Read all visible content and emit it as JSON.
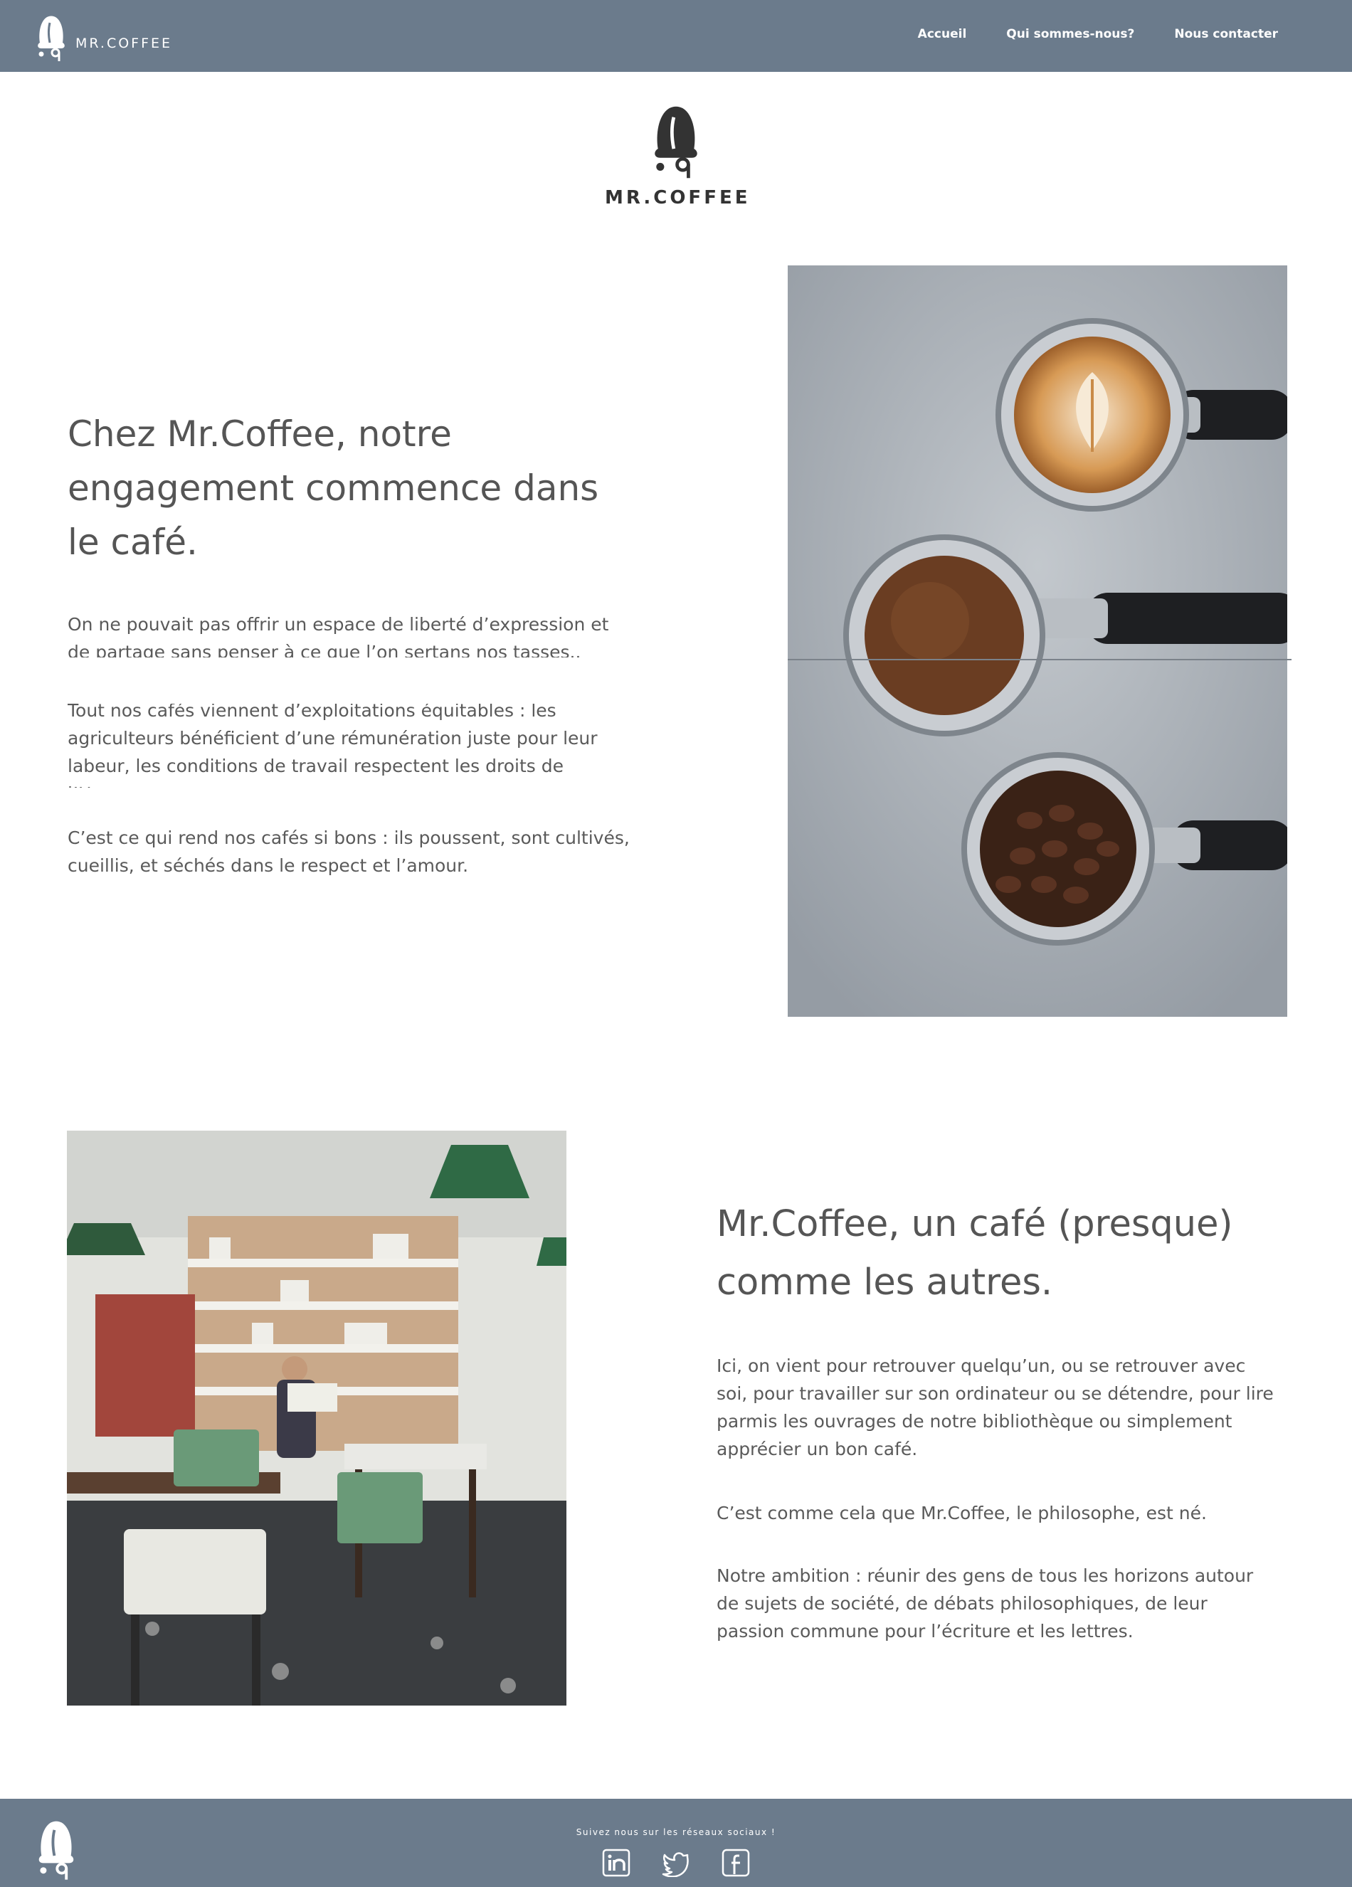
{
  "nav": {
    "brand": "MR.COFFEE",
    "links": [
      "Accueil",
      "Qui sommes-nous?",
      "Nous contacter"
    ]
  },
  "hero": {
    "brand": "MR.COFFEE"
  },
  "section1": {
    "title": "Chez Mr.Coffee, notre engagement commence dans le café.",
    "p1": "On ne pouvait pas offrir un espace de liberté d’expression et de partage sans penser à ce que l’on sertans nos tasses..",
    "p2": "Tout nos cafés viennent d’exploitations équitables : les agriculteurs bénéficient d’une rémunération juste pour leur labeur, les conditions de travail respectent les droits de l’Homme.",
    "p3": "C’est ce qui rend nos cafés si bons : ils poussent, sont cultivés, cueillis, et séchés dans le respect et l’amour."
  },
  "section2": {
    "title": "Mr.Coffee, un café (presque) comme les autres.",
    "p1": "Ici, on vient pour retrouver quelqu’un, ou se retrouver avec soi, pour travailler sur son ordinateur ou se détendre, pour lire parmis les ouvrages de notre bibliothèque ou simplement apprécier un bon café.",
    "p2": "C’est comme cela que Mr.Coffee, le philosophe, est né.",
    "p3": "Notre ambition : réunir des gens de tous les horizons autour de sujets de société, de débats philosophiques, de leur passion commune pour l’écriture et les lettres."
  },
  "footer": {
    "text": "Suivez nous sur les réseaux sociaux !",
    "socials": [
      "linkedin-icon",
      "twitter-icon",
      "facebook-icon"
    ]
  },
  "colors": {
    "bar": "#6b7b8c",
    "text": "#555555"
  }
}
